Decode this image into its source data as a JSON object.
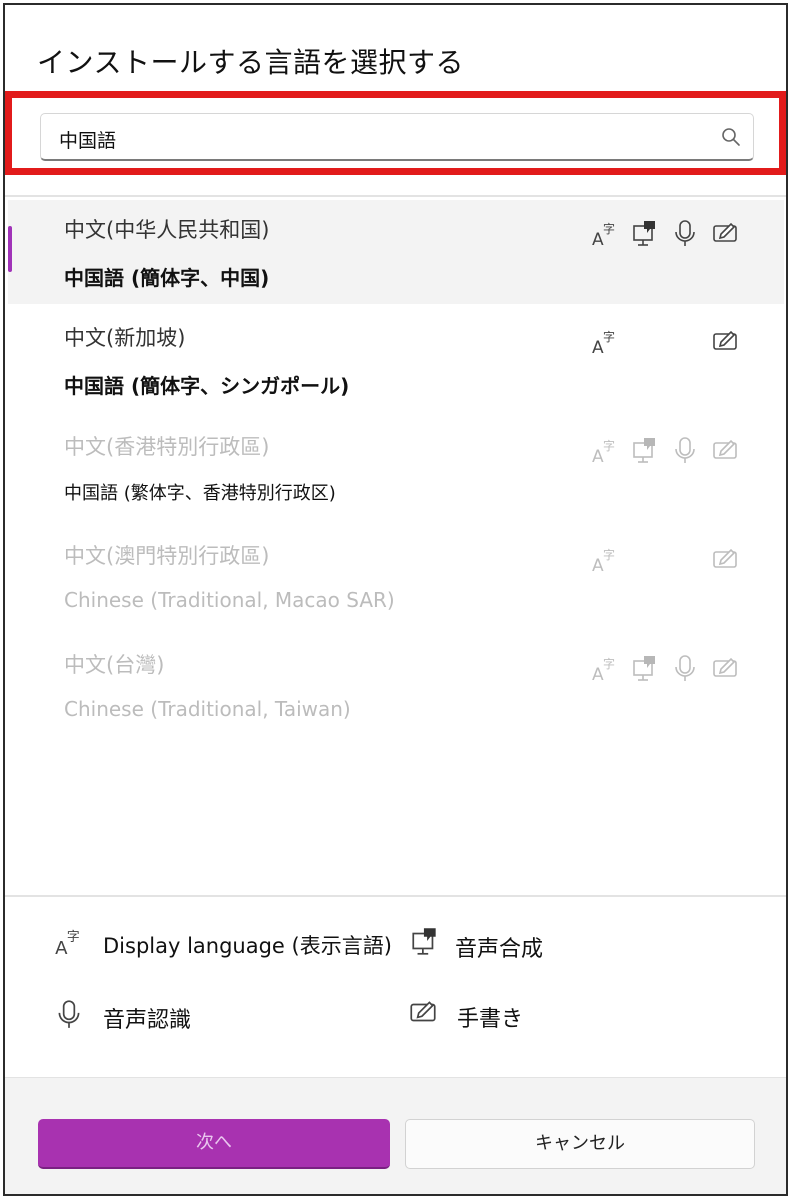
{
  "dialog": {
    "title": "インストールする言語を選択する"
  },
  "search": {
    "value": "中国語",
    "icon": "search-icon"
  },
  "languages": [
    {
      "name": "中文(中华人民共和国)",
      "subtitle": "中国語 (簡体字、中国)",
      "state": "selected",
      "features": [
        "display-language",
        "text-to-speech",
        "speech-recognition",
        "handwriting"
      ]
    },
    {
      "name": "中文(新加坡)",
      "subtitle": "中国語 (簡体字、シンガポール)",
      "state": "enabled",
      "features": [
        "display-language",
        "handwriting"
      ]
    },
    {
      "name": "中文(香港特別行政區)",
      "subtitle": "中国語 (繁体字、香港特別行政区)",
      "state": "disabled",
      "features": [
        "display-language",
        "text-to-speech",
        "speech-recognition",
        "handwriting"
      ]
    },
    {
      "name": "中文(澳門特別行政區)",
      "subtitle": "Chinese (Traditional, Macao SAR)",
      "state": "disabled",
      "features": [
        "display-language",
        "handwriting"
      ]
    },
    {
      "name": "中文(台灣)",
      "subtitle": "Chinese (Traditional, Taiwan)",
      "state": "disabled",
      "features": [
        "display-language",
        "text-to-speech",
        "speech-recognition",
        "handwriting"
      ]
    }
  ],
  "legend": {
    "display_language": "Display language (表示言語)",
    "text_to_speech": "音声合成",
    "speech_recognition": "音声認識",
    "handwriting": "手書き"
  },
  "buttons": {
    "next": "次へ",
    "cancel": "キャンセル"
  },
  "colors": {
    "accent": "#a832b0",
    "highlight_border": "#e21b1b"
  }
}
